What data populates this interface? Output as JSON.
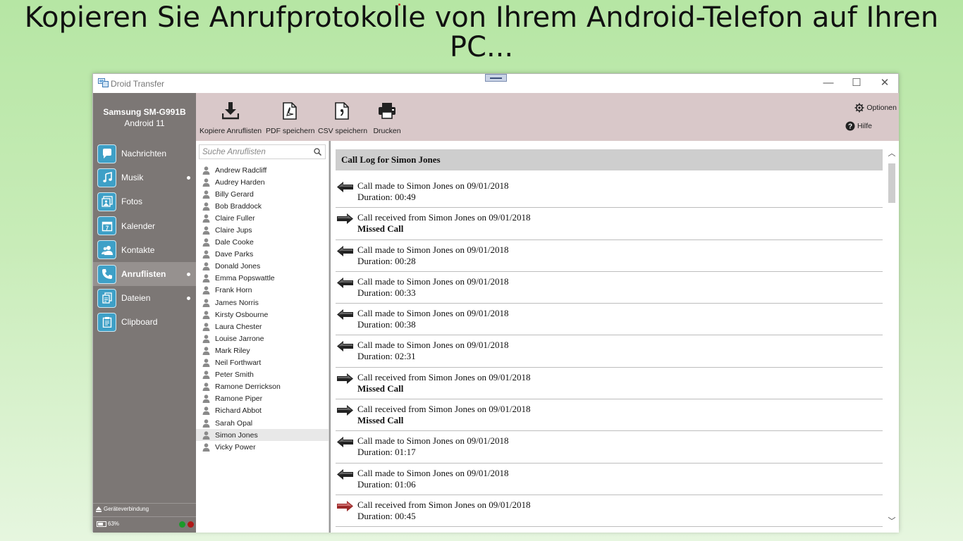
{
  "headline": "Kopieren Sie Anrufprotokolle von Ihrem Android-Telefon auf Ihren PC...",
  "window": {
    "title": "Droid Transfer",
    "minimize": "—",
    "maximize": "☐",
    "close": "✕"
  },
  "device": {
    "name": "Samsung SM-G991B",
    "os": "Android 11"
  },
  "nav": [
    {
      "label": "Nachrichten",
      "icon": "chat-bubble-icon",
      "active": false,
      "dot": false
    },
    {
      "label": "Musik",
      "icon": "music-note-icon",
      "active": false,
      "dot": true
    },
    {
      "label": "Fotos",
      "icon": "photo-icon",
      "active": false,
      "dot": false
    },
    {
      "label": "Kalender",
      "icon": "calendar-icon",
      "active": false,
      "dot": false
    },
    {
      "label": "Kontakte",
      "icon": "contacts-icon",
      "active": false,
      "dot": false
    },
    {
      "label": "Anruflisten",
      "icon": "phone-icon",
      "active": true,
      "dot": true
    },
    {
      "label": "Dateien",
      "icon": "files-icon",
      "active": false,
      "dot": true
    },
    {
      "label": "Clipboard",
      "icon": "clipboard-icon",
      "active": false,
      "dot": false
    }
  ],
  "connection": "Geräteverbindung",
  "battery": "63%",
  "toolbar": {
    "copy": "Kopiere Anruflisten",
    "pdf": "PDF speichern",
    "csv": "CSV speichern",
    "print": "Drucken",
    "options": "Optionen",
    "help": "Hilfe"
  },
  "search": {
    "placeholder": "Suche Anruflisten"
  },
  "contacts": [
    "Andrew Radcliff",
    "Audrey Harden",
    "Billy Gerard",
    "Bob Braddock",
    "Claire Fuller",
    "Claire Jups",
    "Dale Cooke",
    "Dave Parks",
    "Donald Jones",
    "Emma Popswattle",
    "Frank Horn",
    "James Norris",
    "Kirsty Osbourne",
    "Laura Chester",
    "Louise Jarrone",
    "Mark Riley",
    "Neil Forthwart",
    "Peter Smith",
    "Ramone Derrickson",
    "Ramone Piper",
    "Richard Abbot",
    "Sarah Opal",
    "Simon Jones",
    "Vicky Power"
  ],
  "selected_contact": "Simon Jones",
  "log": {
    "header": "Call Log for Simon Jones",
    "entries": [
      {
        "type": "outgoing",
        "text": "Call made to Simon Jones on 09/01/2018",
        "detail": "Duration: 00:49"
      },
      {
        "type": "missed",
        "text": "Call received from Simon Jones on 09/01/2018",
        "detail": "Missed Call"
      },
      {
        "type": "outgoing",
        "text": "Call made to Simon Jones on 09/01/2018",
        "detail": "Duration: 00:28"
      },
      {
        "type": "outgoing",
        "text": "Call made to Simon Jones on 09/01/2018",
        "detail": "Duration: 00:33"
      },
      {
        "type": "outgoing",
        "text": "Call made to Simon Jones on 09/01/2018",
        "detail": "Duration: 00:38"
      },
      {
        "type": "outgoing",
        "text": "Call made to Simon Jones on 09/01/2018",
        "detail": "Duration: 02:31"
      },
      {
        "type": "missed",
        "text": "Call received from Simon Jones on 09/01/2018",
        "detail": "Missed Call"
      },
      {
        "type": "missed",
        "text": "Call received from Simon Jones on 09/01/2018",
        "detail": "Missed Call"
      },
      {
        "type": "outgoing",
        "text": "Call made to Simon Jones on 09/01/2018",
        "detail": "Duration: 01:17"
      },
      {
        "type": "outgoing",
        "text": "Call made to Simon Jones on 09/01/2018",
        "detail": "Duration: 01:06"
      },
      {
        "type": "incoming",
        "text": "Call received from Simon Jones on 09/01/2018",
        "detail": "Duration: 00:45"
      }
    ]
  },
  "colors": {
    "background_gradient_top": "#b6e6a4",
    "sidebar": "#7c7775",
    "toolbar": "#d9c8c9",
    "nav_icon": "#3ea0c7",
    "incoming_arrow": "#9b2a2a",
    "led_green": "#1a9a2a",
    "led_red": "#b01818"
  }
}
